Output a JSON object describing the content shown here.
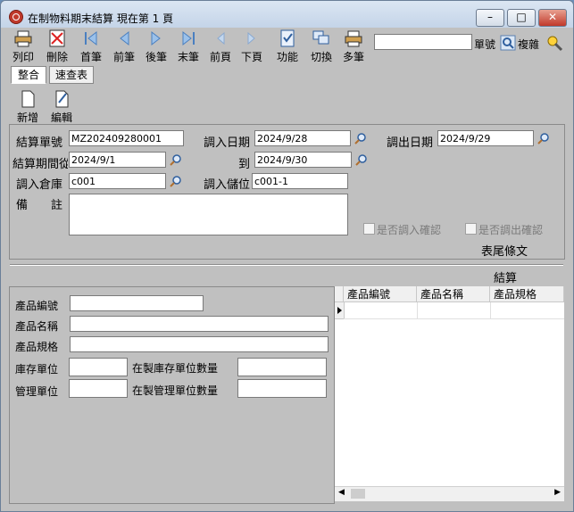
{
  "window": {
    "title": "在制物料期末結算  現在第 1 頁",
    "minimize": "–",
    "maximize": "□",
    "close": "✕"
  },
  "toolbar": {
    "print": "列印",
    "delete": "刪除",
    "first": "首筆",
    "prev": "前筆",
    "next": "後筆",
    "last": "末筆",
    "prev_page": "前頁",
    "next_page": "下頁",
    "function": "功能",
    "switch": "切換",
    "multi": "多筆",
    "doc_no_label": "單號",
    "copy_label": "複雜",
    "search_value": ""
  },
  "tabs": {
    "integrate": "整合",
    "quick": "速查表"
  },
  "actions": {
    "new": "新增",
    "edit": "編輯"
  },
  "form": {
    "settle_no_label": "結算單號",
    "settle_no": "MZ202409280001",
    "in_date_label": "調入日期",
    "in_date": "2024/9/28",
    "out_date_label": "調出日期",
    "out_date": "2024/9/29",
    "period_label": "結算期間從",
    "period_from": "2024/9/1",
    "to_label": "到",
    "period_to": "2024/9/30",
    "in_warehouse_label": "調入倉庫",
    "in_warehouse": "c001",
    "in_location_label": "調入儲位",
    "in_location": "c001-1",
    "remark_label": "備　　註",
    "remark": "",
    "confirm_in": "是否調入確認",
    "confirm_out": "是否調出確認",
    "footer_barcode": "表尾條文",
    "settle": "結算"
  },
  "detail": {
    "product_no_label": "產品編號",
    "product_name_label": "產品名稱",
    "product_spec_label": "產品規格",
    "stock_unit_label": "庫存單位",
    "wip_stock_qty_label": "在製庫存單位數量",
    "mgmt_unit_label": "管理單位",
    "wip_mgmt_qty_label": "在製管理單位數量",
    "product_no": "",
    "product_name": "",
    "product_spec": "",
    "stock_unit": "",
    "wip_stock_qty": "",
    "mgmt_unit": "",
    "wip_mgmt_qty": ""
  },
  "grid": {
    "columns": [
      "產品編號",
      "產品名稱",
      "產品規格"
    ]
  }
}
